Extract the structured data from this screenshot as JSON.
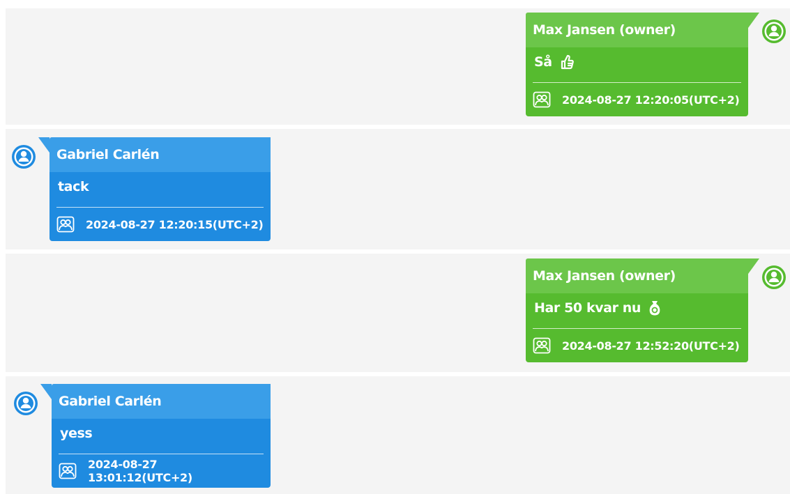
{
  "colors": {
    "owner_header": "#6cc64a",
    "owner_body": "#56bb2f",
    "other_header": "#3a9ee8",
    "other_body": "#1f8be0",
    "row_background": "#f4f4f4"
  },
  "messages": [
    {
      "sender": "Max Jansen (owner)",
      "text": "Så",
      "emoji": "thumbs-up-icon",
      "timestamp": "2024-08-27 12:20:05(UTC+2)",
      "side": "right"
    },
    {
      "sender": "Gabriel Carlén",
      "text": "tack",
      "timestamp": "2024-08-27 12:20:15(UTC+2)",
      "side": "left"
    },
    {
      "sender": "Max Jansen (owner)",
      "text": "Har 50 kvar nu",
      "emoji": "money-bag-icon",
      "timestamp": "2024-08-27 12:52:20(UTC+2)",
      "side": "right"
    },
    {
      "sender": "Gabriel Carlén",
      "text": "yess",
      "timestamp": "2024-08-27 13:01:12(UTC+2)",
      "side": "left"
    }
  ]
}
